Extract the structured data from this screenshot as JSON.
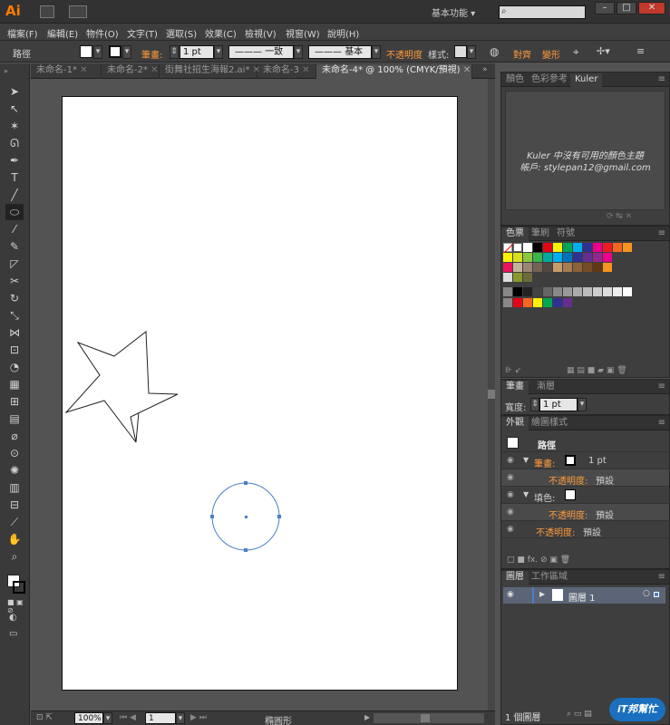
{
  "app": {
    "logo": "Ai",
    "workspace": "基本功能",
    "search_placeholder": ""
  },
  "menu": [
    "檔案(F)",
    "編輯(E)",
    "物件(O)",
    "文字(T)",
    "選取(S)",
    "效果(C)",
    "檢視(V)",
    "視窗(W)",
    "說明(H)"
  ],
  "control": {
    "selection_label": "路徑",
    "stroke_label": "筆畫:",
    "stroke_value": "1 pt",
    "profile_label": "一致",
    "brush_label": "基本",
    "opacity_label": "不透明度",
    "style_label": "樣式:",
    "align_label": "對齊",
    "transform_label": "變形"
  },
  "tabs": [
    "未命名-1*",
    "未命名-2*",
    "街舞社招生海報2.ai*",
    "未命名-3",
    "未命名-4* @ 100% (CMYK/預視)"
  ],
  "status": {
    "zoom": "100%",
    "page": "1",
    "tool": "橢圓形"
  },
  "kuler": {
    "tabs": [
      "顏色",
      "色彩參考",
      "Kuler"
    ],
    "message": "Kuler 中沒有可用的顏色主題",
    "account": "帳戶: stylepan12@gmail.com"
  },
  "swatches": {
    "tabs": [
      "色票",
      "筆刷",
      "符號"
    ],
    "row1": [
      "#ffffff",
      "#000000",
      "#e30613",
      "#fff200",
      "#00a651",
      "#00aeef",
      "#2e3192",
      "#ec008c",
      "#ed1c24",
      "#f26522",
      "#f7941d"
    ],
    "row2": [
      "#fff200",
      "#d7df23",
      "#8dc63f",
      "#39b54a",
      "#00a99d",
      "#00aeef",
      "#0072bc",
      "#2e3192",
      "#662d91",
      "#92278f",
      "#ec008c"
    ],
    "row3": [
      "#ed145b",
      "#c2b59b",
      "#998675",
      "#736357",
      "#534741",
      "#c69c6d",
      "#a67c52",
      "#8c6239",
      "#754c24",
      "#603913",
      "#f7941d"
    ],
    "row5": [
      "#000000",
      "#222222",
      "#444444",
      "#666666",
      "#888888",
      "#999999",
      "#aaaaaa",
      "#bbbbbb",
      "#cccccc",
      "#dddddd",
      "#eeeeee",
      "#ffffff"
    ],
    "row6": [
      "#e30613",
      "#f26522",
      "#fff200",
      "#00a651",
      "#2e3192",
      "#662d91"
    ]
  },
  "stroke_panel": {
    "tabs": [
      "筆畫",
      "漸層"
    ],
    "weight_label": "寬度:",
    "weight_value": "1 pt"
  },
  "appearance": {
    "tabs": [
      "外觀",
      "繪圖樣式"
    ],
    "title": "路徑",
    "stroke_label": "筆畫:",
    "stroke_value": "1 pt",
    "opacity_label": "不透明度:",
    "opacity_value": "預設",
    "fill_label": "填色:",
    "fill_opacity_label": "不透明度:",
    "fill_opacity_value": "預設",
    "obj_opacity_label": "不透明度:",
    "obj_opacity_value": "預設"
  },
  "layers": {
    "tabs": [
      "圖層",
      "工作區域"
    ],
    "layer_name": "圖層 1",
    "footer": "1 個圖層"
  },
  "watermark": "iT邦幫忙"
}
